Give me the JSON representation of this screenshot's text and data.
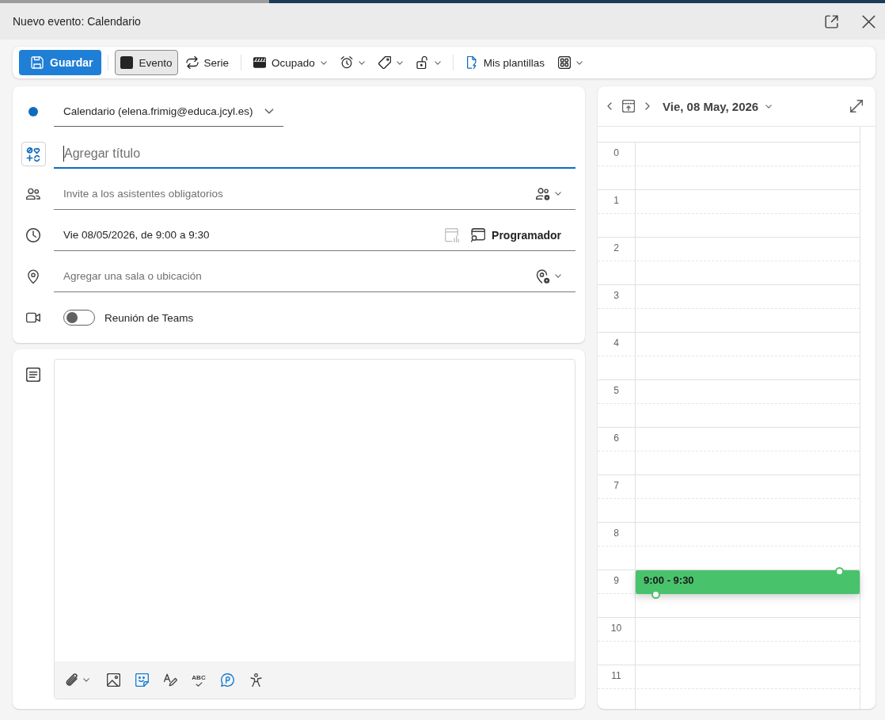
{
  "window": {
    "title": "Nuevo evento: Calendario"
  },
  "toolbar": {
    "save_button": {
      "label": "Guardar"
    },
    "event_button": {
      "label": "Evento",
      "selected": true
    },
    "series_button": {
      "label": "Serie",
      "selected": false
    },
    "show_as": {
      "value": "Ocupado"
    },
    "templates_button": {
      "label": "Mis plantillas"
    }
  },
  "form": {
    "calendar": {
      "value": "Calendario (elena.frimig@educa.jcyl.es)"
    },
    "title_field": {
      "placeholder": "Agregar título",
      "focused": true
    },
    "attendees_field": {
      "placeholder": "Invite a los asistentes obligatorios"
    },
    "date_time": {
      "value": "Vie 08/05/2026, de 9:00 a 9:30"
    },
    "scheduler_button": {
      "label": "Programador"
    },
    "location_field": {
      "placeholder": "Agregar una sala o ubicación"
    },
    "teams_meeting": {
      "label": "Reunión de Teams",
      "on": false
    }
  },
  "editor_toolbar": {
    "spelling_label": "ABC"
  },
  "day_view": {
    "date": "Vie, 08 May, 2026",
    "hours": [
      {
        "label": "0"
      },
      {
        "label": "1"
      },
      {
        "label": "2"
      },
      {
        "label": "3"
      },
      {
        "label": "4"
      },
      {
        "label": "5"
      },
      {
        "label": "6"
      },
      {
        "label": "7"
      },
      {
        "label": "8"
      },
      {
        "label": "9",
        "events": [
          {
            "time": "9:00 - 9:30"
          }
        ]
      },
      {
        "label": "10"
      },
      {
        "label": "11"
      }
    ]
  }
}
